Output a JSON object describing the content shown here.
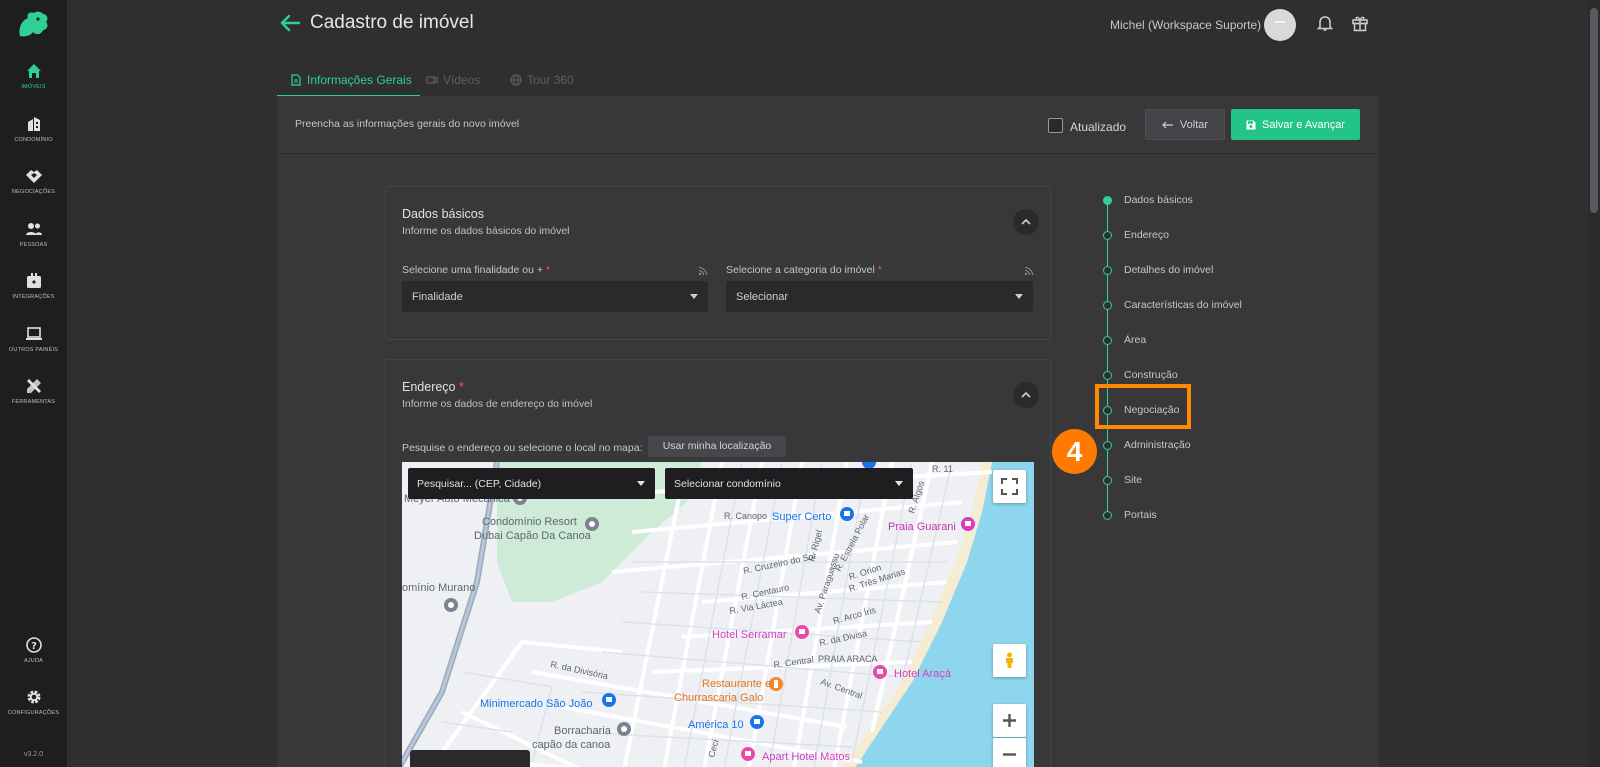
{
  "header": {
    "title": "Cadastro de imóvel",
    "user_name": "Michel (Workspace Suporte)"
  },
  "sidebar": {
    "items": [
      {
        "label": "IMÓVEIS",
        "icon": "home-icon"
      },
      {
        "label": "CONDOMÍNIO",
        "icon": "building-icon"
      },
      {
        "label": "NEGOCIAÇÕES",
        "icon": "handshake-icon"
      },
      {
        "label": "PESSOAS",
        "icon": "people-icon"
      },
      {
        "label": "INTEGRAÇÕES",
        "icon": "integrations-icon"
      },
      {
        "label": "OUTROS PAINÉIS",
        "icon": "laptop-icon"
      },
      {
        "label": "FERRAMENTAS",
        "icon": "tools-icon"
      }
    ],
    "bottom": [
      {
        "label": "AJUDA",
        "icon": "help-icon"
      },
      {
        "label": "CONFIGURAÇÕES",
        "icon": "gear-icon"
      }
    ],
    "version": "v3.2.0"
  },
  "tabs": [
    {
      "label": "Informações Gerais",
      "active": true
    },
    {
      "label": "Vídeos",
      "active": false
    },
    {
      "label": "Tour 360",
      "active": false
    }
  ],
  "toolbar": {
    "description": "Preencha as informações gerais do novo imóvel",
    "checkbox_label": "Atualizado",
    "back_label": "Voltar",
    "save_label": "Salvar e Avançar"
  },
  "basic": {
    "title": "Dados básicos",
    "subtitle": "Informe os dados básicos do imóvel",
    "finalidade_label": "Selecione uma finalidade ou +",
    "finalidade_value": "Finalidade",
    "categoria_label": "Selecione a categoria do imóvel",
    "categoria_value": "Selecionar",
    "required_mark": "*"
  },
  "address": {
    "title": "Endereço",
    "subtitle": "Informe os dados de endereço do imóvel",
    "search_label": "Pesquise o endereço ou selecione o local no mapa:",
    "location_button": "Usar minha localização",
    "search_placeholder": "Pesquisar... (CEP, Cidade)",
    "condo_placeholder": "Selecionar condomínio"
  },
  "map_labels": {
    "meyer": "Meyer Auto Mecânica",
    "resort1": "Condomínio Resort",
    "resort2": "Dubai Capão Da Canoa",
    "murano": "omínio Murano",
    "canopo": "R. Canopo",
    "super_certo": "Super Certo",
    "praia_guarani": "Praia Guarani",
    "rigel": "R. Rigel",
    "estrela_polar": "R. Estrela Polar",
    "algos": "R. Algos",
    "cruzeiro": "R. Cruzeiro do Sul",
    "paraguassu": "Av. Paraguassu",
    "tres_marias": "R. Três Marias",
    "orion": "R. Orion",
    "centauro": "R. Centauro",
    "via_lactea": "R. Via Láctea",
    "arco_iris": "R. Arco Íris",
    "serramar": "Hotel Serramar",
    "divisa_r": "R. da Divisa",
    "central": "R. Central",
    "praia_araca": "PRAIA ARACA",
    "hotel_araca": "Hotel Araçá",
    "divisoria": "R. da Divisória",
    "rest1": "Restaurante e",
    "rest2": "Churrascaria Galo",
    "av_central": "Av. Central",
    "minimercado": "Minimercado São João",
    "america": "América 10",
    "borracharia1": "Borracharia",
    "borracharia2": "capão da canoa",
    "apart": "Apart Hotel Matos",
    "r11": "R. 11",
    "ceci": "Ceci"
  },
  "steps": [
    {
      "label": "Dados básicos",
      "active": true
    },
    {
      "label": "Endereço",
      "active": false
    },
    {
      "label": "Detalhes do imóvel",
      "active": false
    },
    {
      "label": "Características do imóvel",
      "active": false
    },
    {
      "label": "Área",
      "active": false
    },
    {
      "label": "Construção",
      "active": false
    },
    {
      "label": "Negociação",
      "active": false
    },
    {
      "label": "Administração",
      "active": false
    },
    {
      "label": "Site",
      "active": false
    },
    {
      "label": "Portais",
      "active": false
    }
  ],
  "annotation": {
    "badge": "4"
  },
  "colors": {
    "accent": "#2fd096",
    "save_button": "#22c487",
    "highlight": "#ff8a00",
    "required": "#ff4d6a"
  }
}
